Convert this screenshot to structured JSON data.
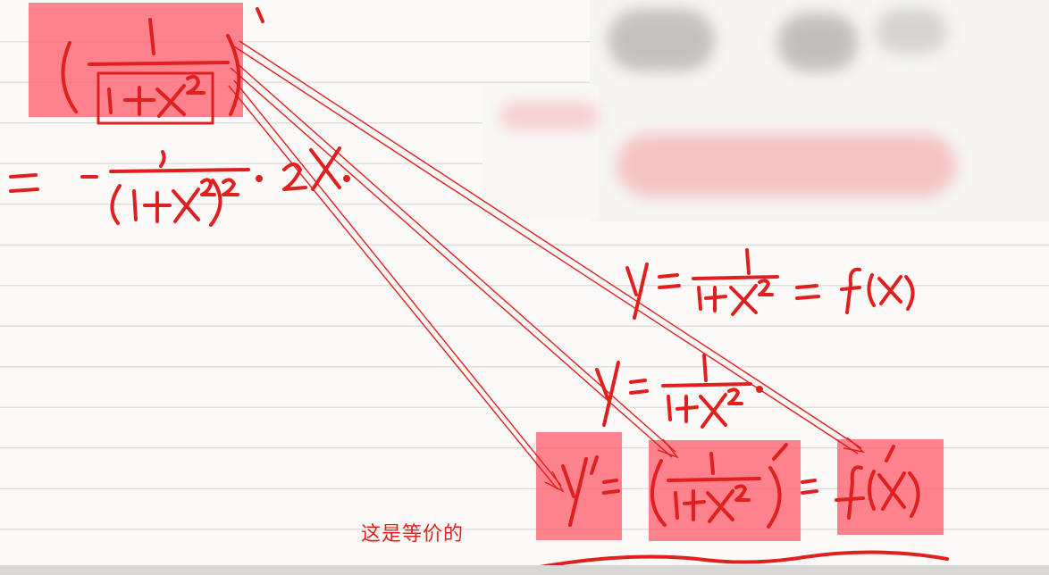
{
  "caption": "这是等价的",
  "colors": {
    "ink": "#e0201e",
    "highlight": "#ff606e",
    "paper": "#fbfaf8"
  },
  "annotations": {
    "highlight_boxes": [
      "source-expression",
      "y-prime",
      "derivative-of-fraction",
      "f-prime-x"
    ],
    "arrows": [
      "to-f-prime-x",
      "to-derivative-of-fraction",
      "to-y-prime"
    ]
  }
}
